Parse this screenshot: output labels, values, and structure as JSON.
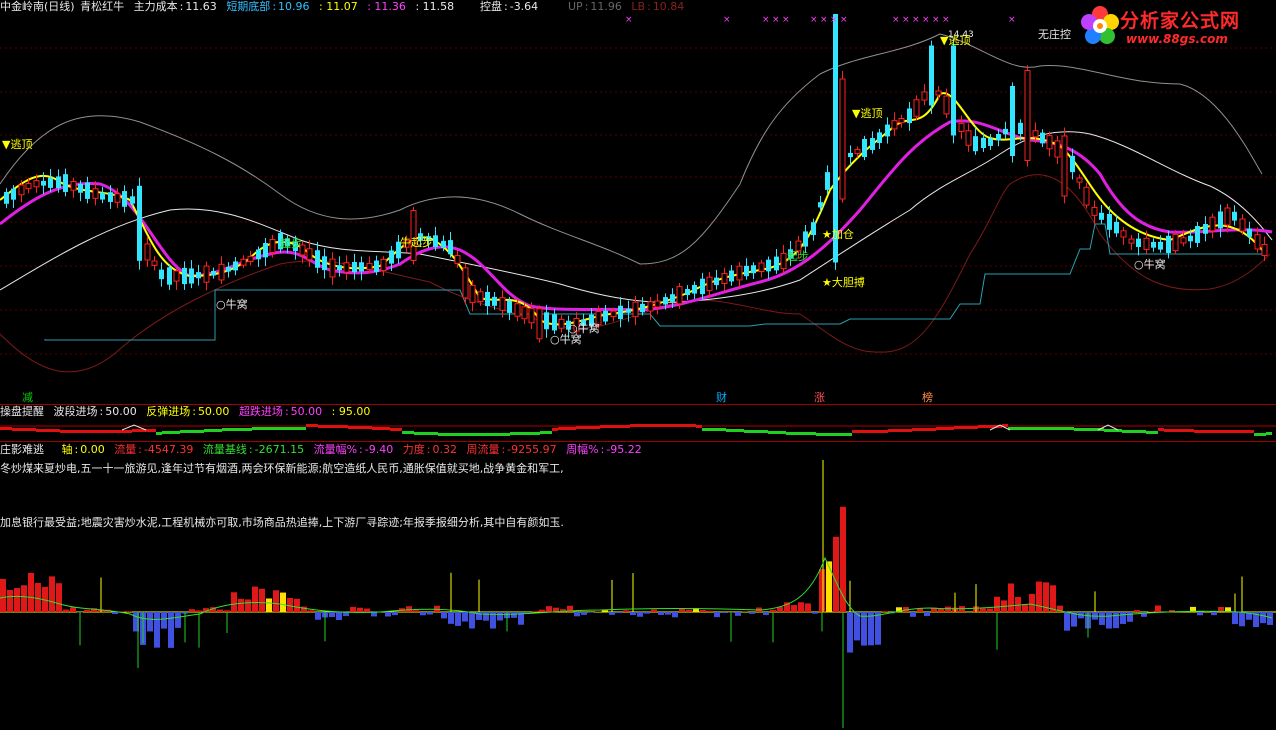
{
  "header": {
    "stock": "中金岭南(日线)",
    "indicator": "青松红牛",
    "cost_label": "主力成本",
    "cost_value": "11.63",
    "short_bottom_label": "短期底部",
    "short_bottom_value": "10.96",
    "v1": ": 11.07",
    "v2": ": 11.36",
    "v3": ": 11.58",
    "control_label": "控盘",
    "control_value": "-3.64",
    "up_label": "UP",
    "up_value": "11.96",
    "lb_label": "LB",
    "lb_value": "10.84",
    "no_dealer": "无庄控",
    "peak_price": "14.43"
  },
  "logo": {
    "title": "分析家公式网",
    "url": "www.88gs.com"
  },
  "chart_signals": {
    "escape_top": "逃顶",
    "niu_wo": "牛窝",
    "qi_bu": "起步",
    "niu_qi_bu": "牛起步",
    "jia_cang": "加仓",
    "da_dan_mai": "大胆搏"
  },
  "category_markers": [
    {
      "label": "减",
      "color": "#00d000"
    },
    {
      "label": "财",
      "color": "#00b0ff"
    },
    {
      "label": "涨",
      "color": "#ff5050"
    },
    {
      "label": "榜",
      "color": "#ff9040"
    }
  ],
  "panel2": {
    "title": "操盘提醒",
    "wave_label": "波段进场",
    "wave_value": "50.00",
    "rebound_label": "反弹进场",
    "rebound_value": "50.00",
    "oversold_label": "超跌进场",
    "oversold_value": "50.00",
    "level_value": ": 95.00"
  },
  "panel3": {
    "title": "庄影难逃",
    "axis_label": "轴",
    "axis_value": "0.00",
    "flow_label": "流量",
    "flow_value": "-4547.39",
    "flow_base_label": "流量基线",
    "flow_base_value": "-2671.15",
    "flow_pct_label": "流量幅%",
    "flow_pct_value": "-9.40",
    "force_label": "力度",
    "force_value": "0.32",
    "week_flow_label": "周流量",
    "week_flow_value": "-9255.97",
    "week_pct_label": "周幅%",
    "week_pct_value": "-95.22"
  },
  "notes": {
    "line1": "冬炒煤来夏炒电,五一十一旅游见,逢年过节有烟酒,两会环保新能源;航空造纸人民币,通胀保值就买地,战争黄金和军工,",
    "line2": "加息银行最受益;地震灾害炒水泥,工程机械亦可取,市场商品热追捧,上下游厂寻踪迹;年报季报细分析,其中自有颜如玉."
  },
  "colors": {
    "up": "#ff2020",
    "down": "#33e6ff",
    "yellow": "#ffff00",
    "magenta": "#e020e0",
    "white": "#e8e8e8",
    "band": "#999999"
  }
}
